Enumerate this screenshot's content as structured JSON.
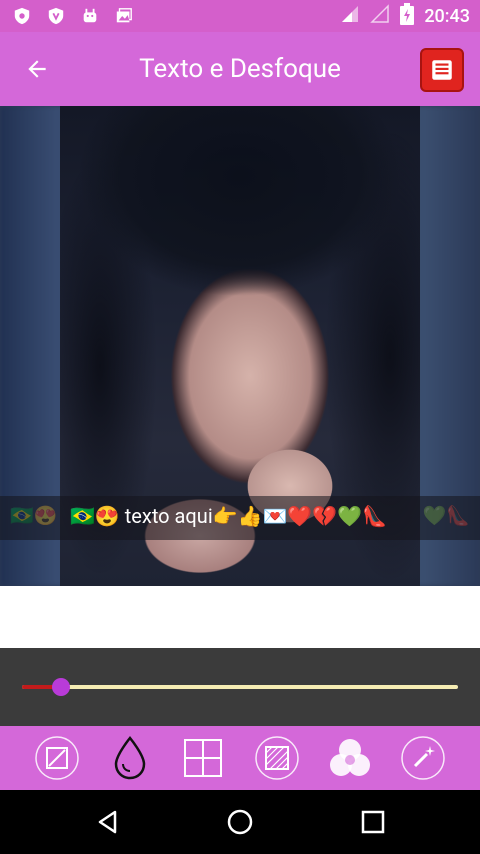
{
  "status_bar": {
    "time": "20:43",
    "left_icons": [
      "shield-icon",
      "shield-v-icon",
      "android-icon",
      "photos-icon"
    ],
    "right_icons": [
      "signal-icon",
      "signal-empty-icon",
      "battery-charging-icon"
    ]
  },
  "app_bar": {
    "title": "Texto e Desfoque",
    "back_icon": "arrow-back-icon",
    "save_icon": "save-icon"
  },
  "canvas": {
    "overlay_text": "🇧🇷😍 texto aqui👉👍💌❤️💔💚👠",
    "ghost_left": "🇧🇷😍",
    "ghost_right": "💚👠"
  },
  "slider": {
    "value_fraction": 0.09,
    "fill_color": "#c21b1b",
    "track_color": "#f5ecb3",
    "thumb_color": "#b93bd8"
  },
  "tools": [
    "edit-square-icon",
    "drop-icon",
    "grid-icon",
    "texture-icon",
    "color-mix-icon",
    "magic-wand-icon"
  ],
  "nav_bar": [
    "back-triangle-icon",
    "home-circle-icon",
    "recents-square-icon"
  ],
  "colors": {
    "status_bar": "#d45fcb",
    "app_bar": "#d468d9",
    "save_button": "#e0241f"
  }
}
